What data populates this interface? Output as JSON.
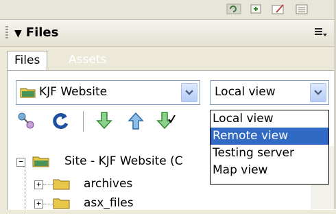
{
  "panel": {
    "title": "Files"
  },
  "tabs": [
    {
      "label": "Files",
      "active": true
    },
    {
      "label": "Assets",
      "active": false
    }
  ],
  "site_select": {
    "value": "KJF Website"
  },
  "view_select": {
    "value": "Local view",
    "options": [
      "Local view",
      "Remote view",
      "Testing server",
      "Map view"
    ],
    "highlighted": "Remote view"
  },
  "tree": {
    "root_label": "Site - KJF Website (C",
    "items": [
      {
        "label": "archives"
      },
      {
        "label": "asx_files"
      }
    ]
  },
  "colors": {
    "highlight": "#316ac5",
    "panel_bg": "#ece9d8",
    "folder": "#e8c84a"
  }
}
